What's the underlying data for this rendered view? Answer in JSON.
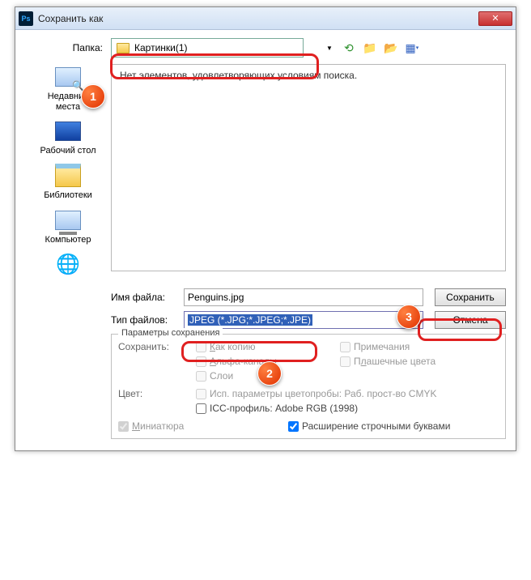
{
  "window": {
    "title": "Сохранить как"
  },
  "folder": {
    "label": "Папка:",
    "value": "Картинки(1)"
  },
  "places": {
    "recent": "Недавние места",
    "desktop": "Рабочий стол",
    "libs": "Библиотеки",
    "computer": "Компьютер"
  },
  "pane": {
    "empty": "Нет элементов, удовлетворяющих условиям поиска."
  },
  "fields": {
    "name_label": "Имя файла:",
    "name_value": "Penguins.jpg",
    "type_label": "Тип файлов:",
    "type_value": "JPEG (*.JPG;*.JPEG;*.JPE)",
    "save_btn": "Сохранить",
    "cancel_btn": "Отмена"
  },
  "params": {
    "legend": "Параметры сохранения",
    "save_label": "Сохранить:",
    "as_copy": "Как копию",
    "notes": "Примечания",
    "alpha": "Альфа-каналы",
    "spot": "Плашечные цвета",
    "layers": "Слои",
    "color_label": "Цвет:",
    "proof": "Исп. параметры цветопробы:  Раб. прост-во CMYK",
    "icc": "ICC-профиль:  Adobe RGB (1998)",
    "thumb": "Миниатюра",
    "lowercase": "Расширение строчными буквами"
  },
  "callouts": {
    "c1": "1",
    "c2": "2",
    "c3": "3"
  }
}
